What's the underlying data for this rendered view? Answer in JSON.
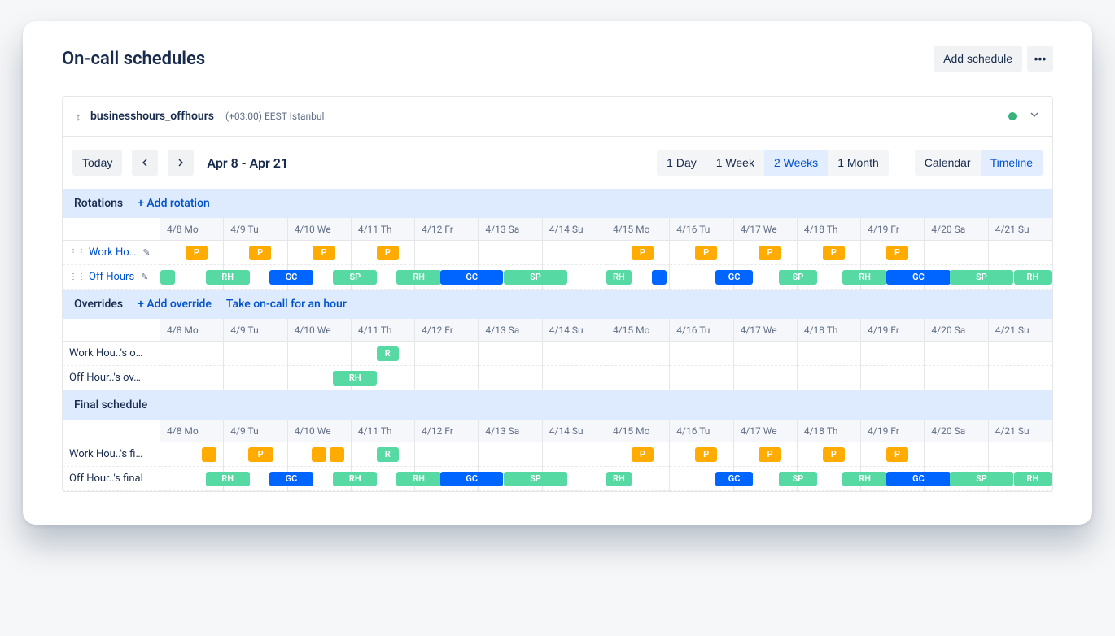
{
  "page": {
    "title": "On-call schedules",
    "add_schedule_label": "Add schedule"
  },
  "schedule": {
    "name": "businesshours_offhours",
    "timezone": "(+03:00) EEST Istanbul",
    "status": "active"
  },
  "toolbar": {
    "today_label": "Today",
    "date_range": "Apr 8 - Apr 21",
    "spans": [
      {
        "label": "1 Day",
        "active": false
      },
      {
        "label": "1 Week",
        "active": false
      },
      {
        "label": "2 Weeks",
        "active": true
      },
      {
        "label": "1 Month",
        "active": false
      }
    ],
    "views": [
      {
        "label": "Calendar",
        "active": false
      },
      {
        "label": "Timeline",
        "active": true
      }
    ]
  },
  "now_marker": {
    "day_index": 3,
    "fraction": 0.75
  },
  "days": [
    "4/8 Mo",
    "4/9 Tu",
    "4/10 We",
    "4/11 Th",
    "4/12 Fr",
    "4/13 Sa",
    "4/14 Su",
    "4/15 Mo",
    "4/16 Tu",
    "4/17 We",
    "4/18 Th",
    "4/19 Fr",
    "4/20 Sa",
    "4/21 Su"
  ],
  "sections": [
    {
      "title": "Rotations",
      "actions": [
        {
          "label": "+ Add rotation"
        }
      ],
      "rows": [
        {
          "label": "Work Ho…",
          "link": true,
          "editable": true,
          "segments": [
            {
              "day": 1,
              "start": 0.4,
              "len": 0.35,
              "text": "P",
              "color": "orange"
            },
            {
              "day": 2,
              "start": 0.4,
              "len": 0.35,
              "text": "P",
              "color": "orange"
            },
            {
              "day": 3,
              "start": 0.4,
              "len": 0.35,
              "text": "P",
              "color": "orange"
            },
            {
              "day": 4,
              "start": 0.4,
              "len": 0.35,
              "text": "P",
              "color": "orange"
            },
            {
              "day": 8,
              "start": 0.4,
              "len": 0.35,
              "text": "P",
              "color": "orange"
            },
            {
              "day": 9,
              "start": 0.4,
              "len": 0.35,
              "text": "P",
              "color": "orange"
            },
            {
              "day": 10,
              "start": 0.4,
              "len": 0.35,
              "text": "P",
              "color": "orange"
            },
            {
              "day": 11,
              "start": 0.4,
              "len": 0.35,
              "text": "P",
              "color": "orange"
            },
            {
              "day": 12,
              "start": 0.4,
              "len": 0.35,
              "text": "P",
              "color": "orange"
            }
          ]
        },
        {
          "label": "Off Hours",
          "link": true,
          "editable": true,
          "segments": [
            {
              "day": 1,
              "start": 0.0,
              "len": 0.06,
              "text": "",
              "color": "green"
            },
            {
              "day": 1,
              "start": 0.72,
              "len": 0.7,
              "text": "RH",
              "color": "green"
            },
            {
              "day": 2,
              "start": 0.72,
              "len": 0.7,
              "text": "GC",
              "color": "blue"
            },
            {
              "day": 3,
              "start": 0.72,
              "len": 0.7,
              "text": "SP",
              "color": "green"
            },
            {
              "day": 4,
              "start": 0.72,
              "len": 0.7,
              "text": "RH",
              "color": "green"
            },
            {
              "day": 5,
              "start": 0.4,
              "len": 1.0,
              "text": "GC",
              "color": "blue"
            },
            {
              "day": 6,
              "start": 0.4,
              "len": 1.0,
              "text": "SP",
              "color": "green"
            },
            {
              "day": 8,
              "start": 0.0,
              "len": 0.4,
              "text": "RH",
              "color": "green"
            },
            {
              "day": 8,
              "start": 0.72,
              "len": 0.08,
              "text": "",
              "color": "blue"
            },
            {
              "day": 9,
              "start": 0.72,
              "len": 0.6,
              "text": "GC",
              "color": "blue"
            },
            {
              "day": 10,
              "start": 0.72,
              "len": 0.6,
              "text": "SP",
              "color": "green"
            },
            {
              "day": 11,
              "start": 0.72,
              "len": 0.7,
              "text": "RH",
              "color": "green"
            },
            {
              "day": 12,
              "start": 0.4,
              "len": 1.02,
              "text": "GC",
              "color": "blue"
            },
            {
              "day": 13,
              "start": 0.4,
              "len": 1.0,
              "text": "SP",
              "color": "green"
            },
            {
              "day": 14,
              "start": 0.4,
              "len": 0.6,
              "text": "RH",
              "color": "green"
            }
          ]
        }
      ]
    },
    {
      "title": "Overrides",
      "actions": [
        {
          "label": "+ Add override"
        },
        {
          "label": "Take on-call for an hour"
        }
      ],
      "rows": [
        {
          "label": "Work Hou..'s o…",
          "link": false,
          "editable": false,
          "segments": [
            {
              "day": 4,
              "start": 0.4,
              "len": 0.35,
              "text": "R",
              "color": "green"
            }
          ]
        },
        {
          "label": "Off Hour..'s ov…",
          "link": false,
          "editable": false,
          "segments": [
            {
              "day": 3,
              "start": 0.72,
              "len": 0.7,
              "text": "RH",
              "color": "green"
            }
          ]
        }
      ]
    },
    {
      "title": "Final schedule",
      "actions": [],
      "rows": [
        {
          "label": "Work Hou..'s fi…",
          "link": false,
          "editable": false,
          "segments": [
            {
              "day": 1,
              "start": 0.66,
              "len": 0.1,
              "text": "",
              "color": "orange"
            },
            {
              "day": 2,
              "start": 0.38,
              "len": 0.4,
              "text": "P",
              "color": "orange"
            },
            {
              "day": 3,
              "start": 0.38,
              "len": 0.1,
              "text": "",
              "color": "orange"
            },
            {
              "day": 3,
              "start": 0.66,
              "len": 0.1,
              "text": "",
              "color": "orange"
            },
            {
              "day": 4,
              "start": 0.4,
              "len": 0.35,
              "text": "R",
              "color": "green"
            },
            {
              "day": 8,
              "start": 0.4,
              "len": 0.35,
              "text": "P",
              "color": "orange"
            },
            {
              "day": 9,
              "start": 0.4,
              "len": 0.35,
              "text": "P",
              "color": "orange"
            },
            {
              "day": 10,
              "start": 0.4,
              "len": 0.35,
              "text": "P",
              "color": "orange"
            },
            {
              "day": 11,
              "start": 0.4,
              "len": 0.35,
              "text": "P",
              "color": "orange"
            },
            {
              "day": 12,
              "start": 0.4,
              "len": 0.35,
              "text": "P",
              "color": "orange"
            }
          ]
        },
        {
          "label": "Off Hour..'s final",
          "link": false,
          "editable": false,
          "segments": [
            {
              "day": 1,
              "start": 0.72,
              "len": 0.7,
              "text": "RH",
              "color": "green"
            },
            {
              "day": 2,
              "start": 0.72,
              "len": 0.7,
              "text": "GC",
              "color": "blue"
            },
            {
              "day": 3,
              "start": 0.72,
              "len": 0.7,
              "text": "RH",
              "color": "green"
            },
            {
              "day": 4,
              "start": 0.72,
              "len": 0.7,
              "text": "RH",
              "color": "green"
            },
            {
              "day": 5,
              "start": 0.4,
              "len": 1.0,
              "text": "GC",
              "color": "blue"
            },
            {
              "day": 6,
              "start": 0.4,
              "len": 1.0,
              "text": "SP",
              "color": "green"
            },
            {
              "day": 8,
              "start": 0.0,
              "len": 0.4,
              "text": "RH",
              "color": "green"
            },
            {
              "day": 9,
              "start": 0.72,
              "len": 0.6,
              "text": "GC",
              "color": "blue"
            },
            {
              "day": 10,
              "start": 0.72,
              "len": 0.6,
              "text": "SP",
              "color": "green"
            },
            {
              "day": 11,
              "start": 0.72,
              "len": 0.7,
              "text": "RH",
              "color": "green"
            },
            {
              "day": 12,
              "start": 0.4,
              "len": 1.02,
              "text": "GC",
              "color": "blue"
            },
            {
              "day": 13,
              "start": 0.4,
              "len": 1.0,
              "text": "SP",
              "color": "green"
            },
            {
              "day": 14,
              "start": 0.4,
              "len": 0.6,
              "text": "RH",
              "color": "green"
            }
          ]
        }
      ]
    }
  ]
}
